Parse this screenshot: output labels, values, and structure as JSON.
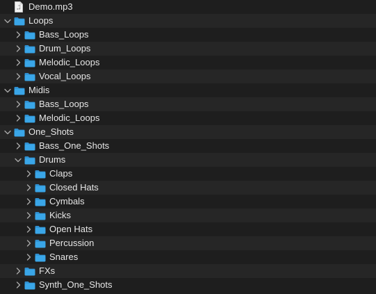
{
  "colors": {
    "background": "#1e1e1e",
    "alt_row": "#262626",
    "folder_body": "#3aa6e8",
    "folder_tab": "#2f8fd0",
    "text": "#e6e6e6",
    "chevron": "#a8a8a8"
  },
  "rows": [
    {
      "label": "Demo.mp3",
      "type": "file",
      "icon": "audio-file-icon",
      "expanded": null,
      "level": 0
    },
    {
      "label": "Loops",
      "type": "folder",
      "icon": "folder-icon",
      "expanded": true,
      "level": 0
    },
    {
      "label": "Bass_Loops",
      "type": "folder",
      "icon": "folder-icon",
      "expanded": false,
      "level": 1
    },
    {
      "label": "Drum_Loops",
      "type": "folder",
      "icon": "folder-icon",
      "expanded": false,
      "level": 1
    },
    {
      "label": "Melodic_Loops",
      "type": "folder",
      "icon": "folder-icon",
      "expanded": false,
      "level": 1
    },
    {
      "label": "Vocal_Loops",
      "type": "folder",
      "icon": "folder-icon",
      "expanded": false,
      "level": 1
    },
    {
      "label": "Midis",
      "type": "folder",
      "icon": "folder-icon",
      "expanded": true,
      "level": 0
    },
    {
      "label": "Bass_Loops",
      "type": "folder",
      "icon": "folder-icon",
      "expanded": false,
      "level": 1
    },
    {
      "label": "Melodic_Loops",
      "type": "folder",
      "icon": "folder-icon",
      "expanded": false,
      "level": 1
    },
    {
      "label": "One_Shots",
      "type": "folder",
      "icon": "folder-icon",
      "expanded": true,
      "level": 0
    },
    {
      "label": "Bass_One_Shots",
      "type": "folder",
      "icon": "folder-icon",
      "expanded": false,
      "level": 1
    },
    {
      "label": "Drums",
      "type": "folder",
      "icon": "folder-icon",
      "expanded": true,
      "level": 1
    },
    {
      "label": "Claps",
      "type": "folder",
      "icon": "folder-icon",
      "expanded": false,
      "level": 2
    },
    {
      "label": "Closed Hats",
      "type": "folder",
      "icon": "folder-icon",
      "expanded": false,
      "level": 2
    },
    {
      "label": "Cymbals",
      "type": "folder",
      "icon": "folder-icon",
      "expanded": false,
      "level": 2
    },
    {
      "label": "Kicks",
      "type": "folder",
      "icon": "folder-icon",
      "expanded": false,
      "level": 2
    },
    {
      "label": "Open Hats",
      "type": "folder",
      "icon": "folder-icon",
      "expanded": false,
      "level": 2
    },
    {
      "label": "Percussion",
      "type": "folder",
      "icon": "folder-icon",
      "expanded": false,
      "level": 2
    },
    {
      "label": "Snares",
      "type": "folder",
      "icon": "folder-icon",
      "expanded": false,
      "level": 2
    },
    {
      "label": "FXs",
      "type": "folder",
      "icon": "folder-icon",
      "expanded": false,
      "level": 1
    },
    {
      "label": "Synth_One_Shots",
      "type": "folder",
      "icon": "folder-icon",
      "expanded": false,
      "level": 1
    }
  ]
}
